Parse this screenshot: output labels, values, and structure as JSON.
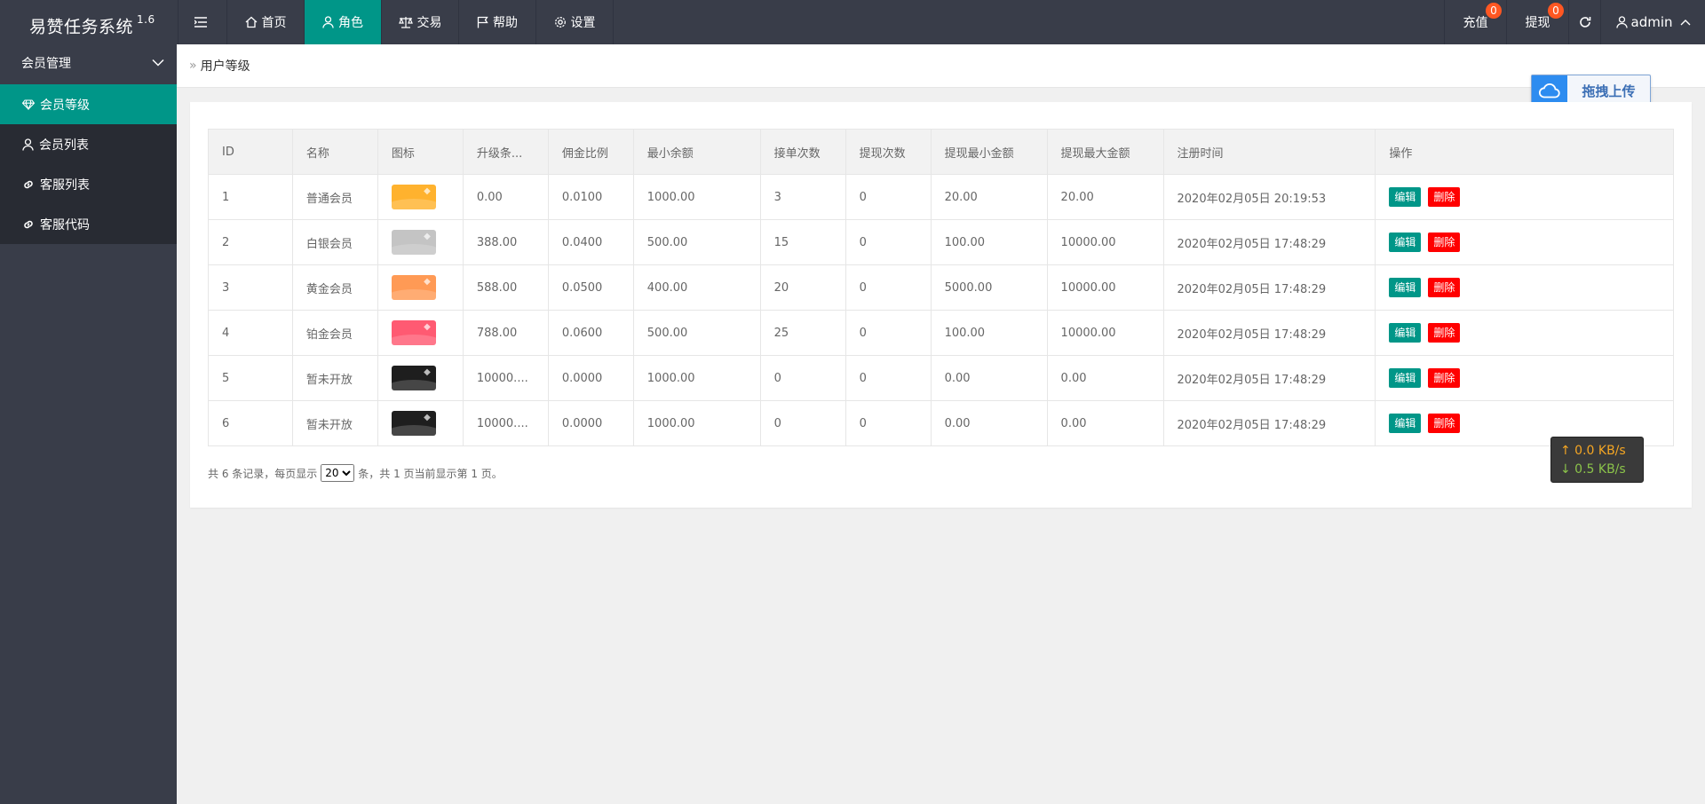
{
  "app": {
    "title": "易赞任务系统",
    "version": "1.6"
  },
  "topnav": {
    "items": [
      {
        "label": "首页",
        "icon": "home-icon"
      },
      {
        "label": "角色",
        "icon": "user-icon"
      },
      {
        "label": "交易",
        "icon": "scale-icon"
      },
      {
        "label": "帮助",
        "icon": "flag-icon"
      },
      {
        "label": "设置",
        "icon": "gear-icon"
      }
    ],
    "active": "角色",
    "recharge": {
      "label": "充值",
      "badge": "0"
    },
    "withdraw": {
      "label": "提现",
      "badge": "0"
    },
    "user": "admin"
  },
  "sidebar": {
    "group": "会员管理",
    "items": [
      {
        "label": "会员等级",
        "icon": "diamond-icon"
      },
      {
        "label": "会员列表",
        "icon": "user-icon"
      },
      {
        "label": "客服列表",
        "icon": "link-icon"
      },
      {
        "label": "客服代码",
        "icon": "link-icon"
      }
    ],
    "active": "会员等级"
  },
  "breadcrumb": "用户等级",
  "upload": {
    "label": "拖拽上传"
  },
  "table": {
    "headers": [
      "ID",
      "名称",
      "图标",
      "升级条...",
      "佣金比例",
      "最小余额",
      "接单次数",
      "提现次数",
      "提现最小金额",
      "提现最大金额",
      "注册时间",
      "操作"
    ],
    "rows": [
      {
        "id": "1",
        "name": "普通会员",
        "color": "#ffb22e",
        "upgrade": "0.00",
        "rate": "0.0100",
        "min_balance": "1000.00",
        "orders": "3",
        "withdraw_times": "0",
        "wd_min": "20.00",
        "wd_max": "20.00",
        "time": "2020年02月05日 20:19:53"
      },
      {
        "id": "2",
        "name": "白银会员",
        "color": "#c4c4c4",
        "upgrade": "388.00",
        "rate": "0.0400",
        "min_balance": "500.00",
        "orders": "15",
        "withdraw_times": "0",
        "wd_min": "100.00",
        "wd_max": "10000.00",
        "time": "2020年02月05日 17:48:29"
      },
      {
        "id": "3",
        "name": "黄金会员",
        "color": "#ff9a55",
        "upgrade": "588.00",
        "rate": "0.0500",
        "min_balance": "400.00",
        "orders": "20",
        "withdraw_times": "0",
        "wd_min": "5000.00",
        "wd_max": "10000.00",
        "time": "2020年02月05日 17:48:29"
      },
      {
        "id": "4",
        "name": "铂金会员",
        "color": "#ff5a72",
        "upgrade": "788.00",
        "rate": "0.0600",
        "min_balance": "500.00",
        "orders": "25",
        "withdraw_times": "0",
        "wd_min": "100.00",
        "wd_max": "10000.00",
        "time": "2020年02月05日 17:48:29"
      },
      {
        "id": "5",
        "name": "暂未开放",
        "color": "#1e1e1e",
        "upgrade": "10000....",
        "rate": "0.0000",
        "min_balance": "1000.00",
        "orders": "0",
        "withdraw_times": "0",
        "wd_min": "0.00",
        "wd_max": "0.00",
        "time": "2020年02月05日 17:48:29"
      },
      {
        "id": "6",
        "name": "暂未开放",
        "color": "#1e1e1e",
        "upgrade": "10000....",
        "rate": "0.0000",
        "min_balance": "1000.00",
        "orders": "0",
        "withdraw_times": "0",
        "wd_min": "0.00",
        "wd_max": "0.00",
        "time": "2020年02月05日 17:48:29"
      }
    ],
    "edit_label": "编辑",
    "delete_label": "删除"
  },
  "pager": {
    "prefix": "共 6 条记录，每页显示",
    "page_size": "20",
    "suffix": "条，共 1 页当前显示第 1 页。"
  },
  "speed": {
    "up": "↑ 0.0 KB/s",
    "down": "↓ 0.5 KB/s"
  }
}
